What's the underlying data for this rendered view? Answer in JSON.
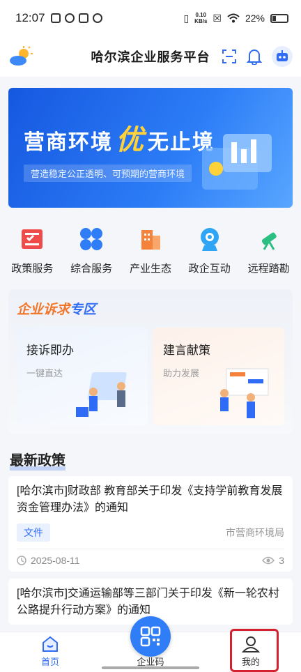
{
  "status_bar": {
    "time": "12:07",
    "net_speed_top": "0.10",
    "net_speed_bottom": "KB/s",
    "battery": "22%"
  },
  "header": {
    "title": "哈尔滨企业服务平台"
  },
  "banner": {
    "headline_left": "营商环境",
    "headline_emph": "优",
    "headline_right": "无止境",
    "subline": "营造稳定公正透明、可预期的营商环境"
  },
  "services": [
    {
      "label": "政策服务",
      "icon": "policy-book-icon",
      "color": "#ef4b4b"
    },
    {
      "label": "综合服务",
      "icon": "four-petal-icon",
      "color": "#2f7df7"
    },
    {
      "label": "产业生态",
      "icon": "factory-building-icon",
      "color": "#f5823a"
    },
    {
      "label": "政企互动",
      "icon": "badge-camera-icon",
      "color": "#2fa6f5"
    },
    {
      "label": "远程踏勘",
      "icon": "telescope-icon",
      "color": "#2bbf82"
    }
  ],
  "appeal": {
    "title_a": "企业诉求",
    "title_b": "专区",
    "cards": [
      {
        "title": "接诉即办",
        "subtitle": "一键直达"
      },
      {
        "title": "建言献策",
        "subtitle": "助力发展"
      }
    ]
  },
  "policies": {
    "section_title": "最新政策",
    "items": [
      {
        "title": "[哈尔滨市]财政部 教育部关于印发《支持学前教育发展资金管理办法》的通知",
        "tag": "文件",
        "dept": "市营商环境局",
        "date": "2025-08-11",
        "views": "3"
      },
      {
        "title": "[哈尔滨市]交通运输部等三部门关于印发《新一轮农村公路提升行动方案》的通知"
      }
    ]
  },
  "tabbar": {
    "home": "首页",
    "qr": "企业码",
    "mine": "我的"
  },
  "colors": {
    "primary": "#2f6bf5",
    "highlight_box": "#d4212f"
  }
}
